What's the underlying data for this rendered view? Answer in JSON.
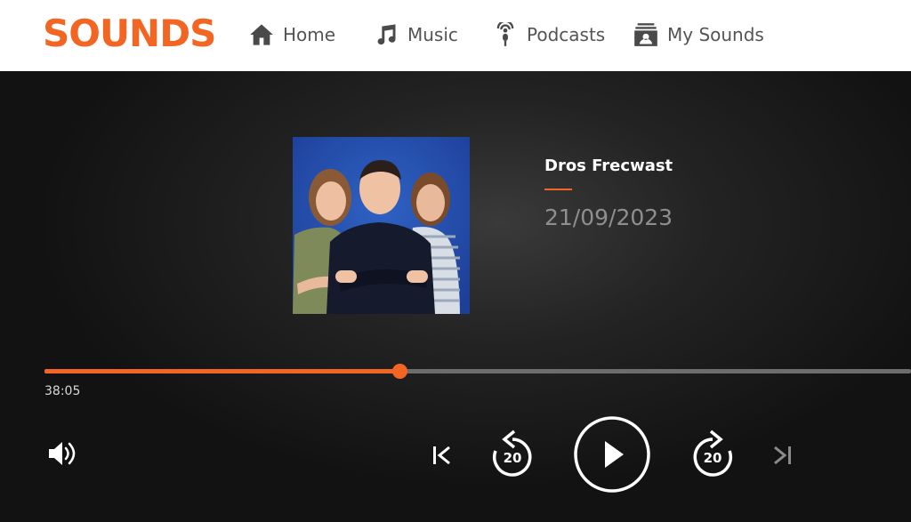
{
  "header": {
    "logo_text": "SOUNDS",
    "nav": [
      {
        "label": "Home",
        "icon": "home-icon"
      },
      {
        "label": "Music",
        "icon": "music-note-icon"
      },
      {
        "label": "Podcasts",
        "icon": "podcast-microphone-icon"
      },
      {
        "label": "My Sounds",
        "icon": "my-sounds-icon"
      }
    ]
  },
  "episode": {
    "title": "Dros Frecwast",
    "date": "21/09/2023",
    "artwork": "presenters-photo"
  },
  "playback": {
    "elapsed": "38:05",
    "progress_fraction": 0.41,
    "state": "paused"
  },
  "controls": {
    "rewind_seconds": "20",
    "forward_seconds": "20",
    "icons": [
      "volume-icon",
      "previous-icon",
      "rewind-20-icon",
      "play-icon",
      "forward-20-icon",
      "next-icon"
    ]
  },
  "colors": {
    "accent": "#f26522",
    "header_bg": "#ffffff",
    "player_bg": "#1a1a1a",
    "track": "#6d6d6d",
    "date_text": "#8f8f8f"
  }
}
